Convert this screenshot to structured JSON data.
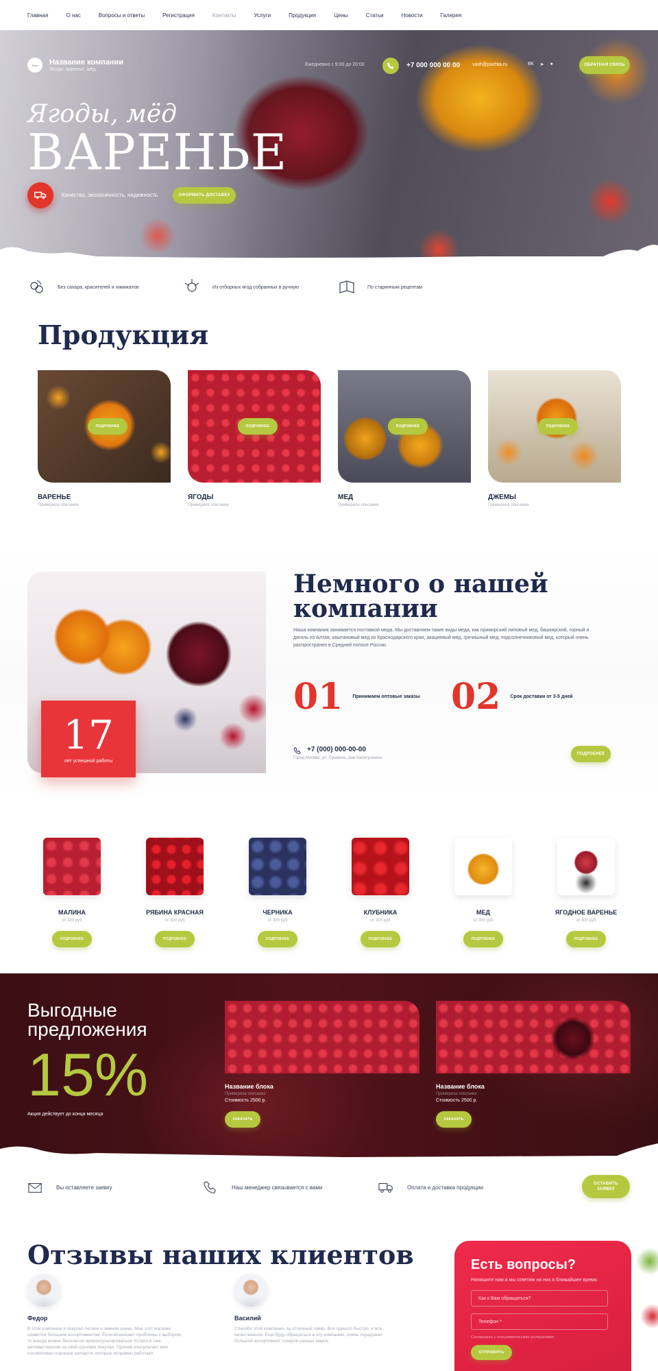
{
  "nav": [
    "Главная",
    "О нас",
    "Вопросы и ответы",
    "Регистрация",
    "Контакты",
    "Услуги",
    "Продукция",
    "Цены",
    "Статьи",
    "Новости",
    "Галерея"
  ],
  "header": {
    "logo_text": "Лого",
    "company_name": "Название компании",
    "company_sub": "Ягоды, варенье, мёд",
    "hours": "Ежедневно с 9:00 до 20:00",
    "phone": "+7 000 000 00 00",
    "email": "vash@pochta.ru",
    "callback": "Обратная связь"
  },
  "hero": {
    "script": "Ягоды, мёд",
    "title": "ВАРЕНЬЕ",
    "quality": "Качество, экологичность, надежность",
    "order_button": "Оформить доставку"
  },
  "features": [
    {
      "icon": "berries-icon",
      "text": "Без сахара, красителей и химикатов"
    },
    {
      "icon": "berry-pick-icon",
      "text": "Из отборных ягод собранных в ручную"
    },
    {
      "icon": "book-icon",
      "text": "По старинным рецептам"
    }
  ],
  "products": {
    "title": "Продукция",
    "more_label": "Подробнее",
    "items": [
      {
        "name": "ВАРЕНЬЕ",
        "desc": "Примерное описание"
      },
      {
        "name": "ЯГОДЫ",
        "desc": "Примерное описание"
      },
      {
        "name": "МЕД",
        "desc": "Примерное описание"
      },
      {
        "name": "ДЖЕМЫ",
        "desc": "Примерное описание"
      }
    ]
  },
  "about": {
    "title": "Немного о нашей компании",
    "text": "Наша компания занимается поставкой меда. Мы доставляем такие виды меда, как приморский липовый мед, башкирский, горный и дягиль из Алтая, каштановый мед из Краснодарского края, акациевый мед, гречишный мед, подсолнечниковый мед, который очень распространен в Средней полосе России.",
    "years": "17",
    "years_label": "лет успешной работы",
    "stats": [
      {
        "num": "01",
        "label": "Принимаем оптовые заказы"
      },
      {
        "num": "02",
        "label": "Срок доставки от 3-5 дней"
      }
    ],
    "phone": "+7 (000) 000-00-00",
    "address": "Город Москва, ул. Пушкина, дом Калатушкина",
    "more": "Подробнее"
  },
  "mini_products": {
    "more_label": "Подробнее",
    "items": [
      {
        "name": "МАЛИНА",
        "price": "от 300 руб"
      },
      {
        "name": "РЯБИНА КРАСНАЯ",
        "price": "от 300 руб"
      },
      {
        "name": "ЧЕРНИКА",
        "price": "от 300 руб"
      },
      {
        "name": "КЛУБНИКА",
        "price": "от 300 руб"
      },
      {
        "name": "МЕД",
        "price": "от 300 руб"
      },
      {
        "name": "ЯГОДНОЕ ВАРЕНЬЕ",
        "price": "от 300 руб"
      }
    ]
  },
  "offers": {
    "title_line1": "Выгодные",
    "title_line2": "предложения",
    "percent": "15%",
    "note": "Акция действует до конца месяца",
    "order_label": "Заказать",
    "cards": [
      {
        "name": "Название блока",
        "desc": "Примерное описание",
        "price": "Стоимость 2500 р."
      },
      {
        "name": "Название блока",
        "desc": "Примерное описание",
        "price": "Стоимость 2500 р."
      }
    ]
  },
  "steps": {
    "items": [
      {
        "icon": "envelope-icon",
        "text": "Вы оставляете заявку"
      },
      {
        "icon": "phone-icon",
        "text": "Наш менеджер связывается с вами"
      },
      {
        "icon": "truck-icon",
        "text": "Оплата и доставка продукции"
      }
    ],
    "button_line1": "Оставить",
    "button_line2": "заявку"
  },
  "reviews": {
    "title": "Отзывы наших клиентов",
    "items": [
      {
        "name": "Федор",
        "text": "В этой компании я покупал летние и зимние шины. Мне этот магазин нравится большим ассортиментом. Если возникают проблемы с выбором, то всегда можно бесплатно проконсультироваться. Кстати и там автомастерская на свой грузовик покупал. Причем консультант мне посоветовал хорошие запчасти, которые исправно работают."
      },
      {
        "name": "Василий",
        "text": "Спасибо этой компании, за отличный товар. Все пришло быстро, и все качественное. Еще буду обращаться в эту компанию, очень порадовал большой ассортимент товаров разных марок."
      }
    ]
  },
  "questions": {
    "title": "Есть вопросы?",
    "text": "Напишите нам и мы ответим на них в ближайшее время.",
    "name_placeholder": "Как к Вам обращаться?",
    "phone_placeholder": "Телефон *",
    "consent": "Соглашаюсь с пользовательским соглашением",
    "send": "Отправить"
  },
  "colors": {
    "accent_green": "#b5c940",
    "accent_red": "#e2352b",
    "navy": "#1f2a4c",
    "questions_red": "#e8253f"
  }
}
